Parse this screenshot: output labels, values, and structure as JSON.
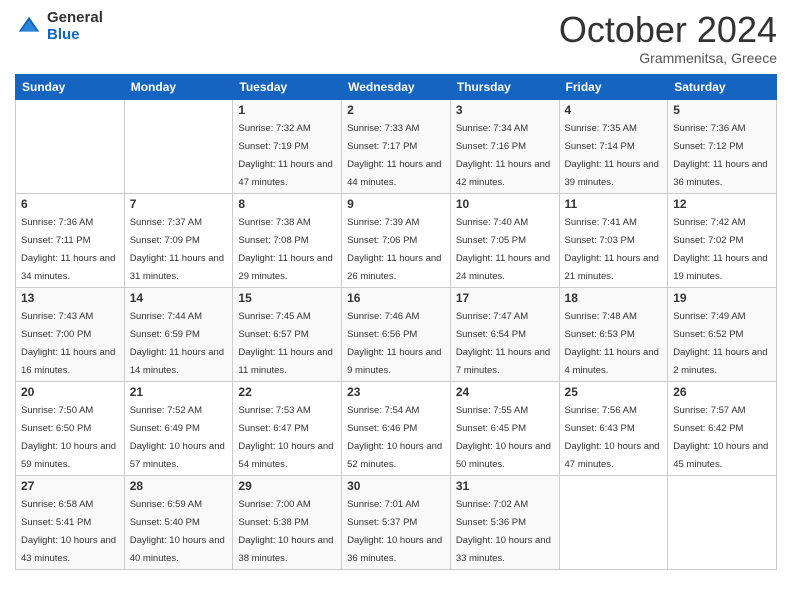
{
  "header": {
    "logo_general": "General",
    "logo_blue": "Blue",
    "month_title": "October 2024",
    "location": "Grammenitsa, Greece"
  },
  "days_of_week": [
    "Sunday",
    "Monday",
    "Tuesday",
    "Wednesday",
    "Thursday",
    "Friday",
    "Saturday"
  ],
  "weeks": [
    [
      {
        "num": "",
        "sunrise": "",
        "sunset": "",
        "daylight": ""
      },
      {
        "num": "",
        "sunrise": "",
        "sunset": "",
        "daylight": ""
      },
      {
        "num": "1",
        "sunrise": "Sunrise: 7:32 AM",
        "sunset": "Sunset: 7:19 PM",
        "daylight": "Daylight: 11 hours and 47 minutes."
      },
      {
        "num": "2",
        "sunrise": "Sunrise: 7:33 AM",
        "sunset": "Sunset: 7:17 PM",
        "daylight": "Daylight: 11 hours and 44 minutes."
      },
      {
        "num": "3",
        "sunrise": "Sunrise: 7:34 AM",
        "sunset": "Sunset: 7:16 PM",
        "daylight": "Daylight: 11 hours and 42 minutes."
      },
      {
        "num": "4",
        "sunrise": "Sunrise: 7:35 AM",
        "sunset": "Sunset: 7:14 PM",
        "daylight": "Daylight: 11 hours and 39 minutes."
      },
      {
        "num": "5",
        "sunrise": "Sunrise: 7:36 AM",
        "sunset": "Sunset: 7:12 PM",
        "daylight": "Daylight: 11 hours and 36 minutes."
      }
    ],
    [
      {
        "num": "6",
        "sunrise": "Sunrise: 7:36 AM",
        "sunset": "Sunset: 7:11 PM",
        "daylight": "Daylight: 11 hours and 34 minutes."
      },
      {
        "num": "7",
        "sunrise": "Sunrise: 7:37 AM",
        "sunset": "Sunset: 7:09 PM",
        "daylight": "Daylight: 11 hours and 31 minutes."
      },
      {
        "num": "8",
        "sunrise": "Sunrise: 7:38 AM",
        "sunset": "Sunset: 7:08 PM",
        "daylight": "Daylight: 11 hours and 29 minutes."
      },
      {
        "num": "9",
        "sunrise": "Sunrise: 7:39 AM",
        "sunset": "Sunset: 7:06 PM",
        "daylight": "Daylight: 11 hours and 26 minutes."
      },
      {
        "num": "10",
        "sunrise": "Sunrise: 7:40 AM",
        "sunset": "Sunset: 7:05 PM",
        "daylight": "Daylight: 11 hours and 24 minutes."
      },
      {
        "num": "11",
        "sunrise": "Sunrise: 7:41 AM",
        "sunset": "Sunset: 7:03 PM",
        "daylight": "Daylight: 11 hours and 21 minutes."
      },
      {
        "num": "12",
        "sunrise": "Sunrise: 7:42 AM",
        "sunset": "Sunset: 7:02 PM",
        "daylight": "Daylight: 11 hours and 19 minutes."
      }
    ],
    [
      {
        "num": "13",
        "sunrise": "Sunrise: 7:43 AM",
        "sunset": "Sunset: 7:00 PM",
        "daylight": "Daylight: 11 hours and 16 minutes."
      },
      {
        "num": "14",
        "sunrise": "Sunrise: 7:44 AM",
        "sunset": "Sunset: 6:59 PM",
        "daylight": "Daylight: 11 hours and 14 minutes."
      },
      {
        "num": "15",
        "sunrise": "Sunrise: 7:45 AM",
        "sunset": "Sunset: 6:57 PM",
        "daylight": "Daylight: 11 hours and 11 minutes."
      },
      {
        "num": "16",
        "sunrise": "Sunrise: 7:46 AM",
        "sunset": "Sunset: 6:56 PM",
        "daylight": "Daylight: 11 hours and 9 minutes."
      },
      {
        "num": "17",
        "sunrise": "Sunrise: 7:47 AM",
        "sunset": "Sunset: 6:54 PM",
        "daylight": "Daylight: 11 hours and 7 minutes."
      },
      {
        "num": "18",
        "sunrise": "Sunrise: 7:48 AM",
        "sunset": "Sunset: 6:53 PM",
        "daylight": "Daylight: 11 hours and 4 minutes."
      },
      {
        "num": "19",
        "sunrise": "Sunrise: 7:49 AM",
        "sunset": "Sunset: 6:52 PM",
        "daylight": "Daylight: 11 hours and 2 minutes."
      }
    ],
    [
      {
        "num": "20",
        "sunrise": "Sunrise: 7:50 AM",
        "sunset": "Sunset: 6:50 PM",
        "daylight": "Daylight: 10 hours and 59 minutes."
      },
      {
        "num": "21",
        "sunrise": "Sunrise: 7:52 AM",
        "sunset": "Sunset: 6:49 PM",
        "daylight": "Daylight: 10 hours and 57 minutes."
      },
      {
        "num": "22",
        "sunrise": "Sunrise: 7:53 AM",
        "sunset": "Sunset: 6:47 PM",
        "daylight": "Daylight: 10 hours and 54 minutes."
      },
      {
        "num": "23",
        "sunrise": "Sunrise: 7:54 AM",
        "sunset": "Sunset: 6:46 PM",
        "daylight": "Daylight: 10 hours and 52 minutes."
      },
      {
        "num": "24",
        "sunrise": "Sunrise: 7:55 AM",
        "sunset": "Sunset: 6:45 PM",
        "daylight": "Daylight: 10 hours and 50 minutes."
      },
      {
        "num": "25",
        "sunrise": "Sunrise: 7:56 AM",
        "sunset": "Sunset: 6:43 PM",
        "daylight": "Daylight: 10 hours and 47 minutes."
      },
      {
        "num": "26",
        "sunrise": "Sunrise: 7:57 AM",
        "sunset": "Sunset: 6:42 PM",
        "daylight": "Daylight: 10 hours and 45 minutes."
      }
    ],
    [
      {
        "num": "27",
        "sunrise": "Sunrise: 6:58 AM",
        "sunset": "Sunset: 5:41 PM",
        "daylight": "Daylight: 10 hours and 43 minutes."
      },
      {
        "num": "28",
        "sunrise": "Sunrise: 6:59 AM",
        "sunset": "Sunset: 5:40 PM",
        "daylight": "Daylight: 10 hours and 40 minutes."
      },
      {
        "num": "29",
        "sunrise": "Sunrise: 7:00 AM",
        "sunset": "Sunset: 5:38 PM",
        "daylight": "Daylight: 10 hours and 38 minutes."
      },
      {
        "num": "30",
        "sunrise": "Sunrise: 7:01 AM",
        "sunset": "Sunset: 5:37 PM",
        "daylight": "Daylight: 10 hours and 36 minutes."
      },
      {
        "num": "31",
        "sunrise": "Sunrise: 7:02 AM",
        "sunset": "Sunset: 5:36 PM",
        "daylight": "Daylight: 10 hours and 33 minutes."
      },
      {
        "num": "",
        "sunrise": "",
        "sunset": "",
        "daylight": ""
      },
      {
        "num": "",
        "sunrise": "",
        "sunset": "",
        "daylight": ""
      }
    ]
  ]
}
